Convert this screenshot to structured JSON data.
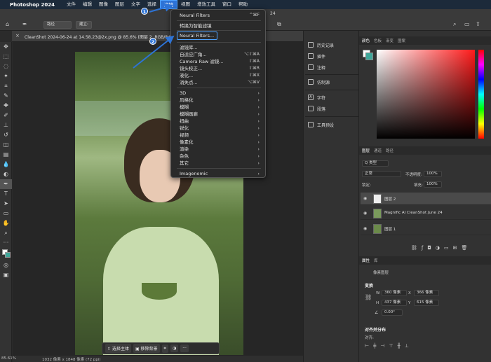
{
  "menubar": {
    "app_name": "Photoshop 2024",
    "items": [
      "文件",
      "编辑",
      "图像",
      "图层",
      "文字",
      "选择",
      "滤镜",
      "视图",
      "增效工具",
      "窗口",
      "帮助"
    ],
    "active_index": 6
  },
  "window": {
    "number_fragment": "24"
  },
  "optionsbar": {
    "mode": "路径",
    "make_label": "建立:",
    "share_label": "共享"
  },
  "document": {
    "tab_title": "CleanShot 2024-06-24 at 14.58.23@2x.png @ 85.6% (图层 2, RGB/8#)"
  },
  "filter_menu": {
    "items": [
      {
        "label": "Neural Filters",
        "shortcut": "^⌘F"
      },
      {
        "label": "转换为智能滤镜",
        "shortcut": ""
      },
      {
        "label": "Neural Filters...",
        "shortcut": "",
        "highlighted": true
      },
      {
        "label": "滤镜库...",
        "shortcut": ""
      },
      {
        "label": "自适应广角...",
        "shortcut": "⌥⇧⌘A"
      },
      {
        "label": "Camera Raw 滤镜...",
        "shortcut": "⇧⌘A"
      },
      {
        "label": "镜头校正...",
        "shortcut": "⇧⌘R"
      },
      {
        "label": "液化...",
        "shortcut": "⇧⌘X"
      },
      {
        "label": "消失点...",
        "shortcut": "⌥⌘V"
      },
      {
        "label": "3D",
        "submenu": true
      },
      {
        "label": "风格化",
        "submenu": true
      },
      {
        "label": "模糊",
        "submenu": true
      },
      {
        "label": "模糊画廊",
        "submenu": true
      },
      {
        "label": "扭曲",
        "submenu": true
      },
      {
        "label": "锐化",
        "submenu": true
      },
      {
        "label": "视频",
        "submenu": true
      },
      {
        "label": "像素化",
        "submenu": true
      },
      {
        "label": "渲染",
        "submenu": true
      },
      {
        "label": "杂色",
        "submenu": true
      },
      {
        "label": "其它",
        "submenu": true
      },
      {
        "label": "Imagenomic",
        "submenu": true
      }
    ]
  },
  "callouts": {
    "badge1": "1",
    "badge2": "2"
  },
  "context_bar": {
    "select_subject": "选择主体",
    "remove_bg": "移除背景",
    "more": "···"
  },
  "statusbar": {
    "zoom": "85.61%",
    "doc_info": "1032 像素 x 1848 像素 (72 ppi)"
  },
  "middle_panel": {
    "items": [
      "历史记录",
      "插件",
      "注释",
      "仿制源",
      "字符",
      "段落",
      "工具预设"
    ]
  },
  "color_panel": {
    "tabs": [
      "颜色",
      "色板",
      "渐变",
      "图案"
    ],
    "fg": "#ffffff",
    "bg": "#3fa79a"
  },
  "layers_panel": {
    "tabs": [
      "图层",
      "通道",
      "路径"
    ],
    "kind_filter": "Q 类型",
    "blend_mode": "正常",
    "opacity_label": "不透明度:",
    "opacity_value": "100%",
    "lock_label": "锁定:",
    "fill_label": "填充:",
    "fill_value": "100%",
    "layers": [
      {
        "name": "图层 2",
        "selected": true
      },
      {
        "name": "Magnific AI CleanShot June 24",
        "selected": false
      },
      {
        "name": "图层 1",
        "selected": false
      }
    ]
  },
  "properties_panel": {
    "tabs": [
      "属性",
      "库"
    ],
    "type": "像素图层",
    "transform_header": "变换",
    "w_label": "W",
    "w_value": "360 像素",
    "h_label": "H",
    "h_value": "437 像素",
    "x_label": "X",
    "x_value": "366 像素",
    "y_label": "Y",
    "y_value": "615 像素",
    "angle_value": "0.00°",
    "align_header": "对齐并分布",
    "align_label": "对齐:"
  }
}
